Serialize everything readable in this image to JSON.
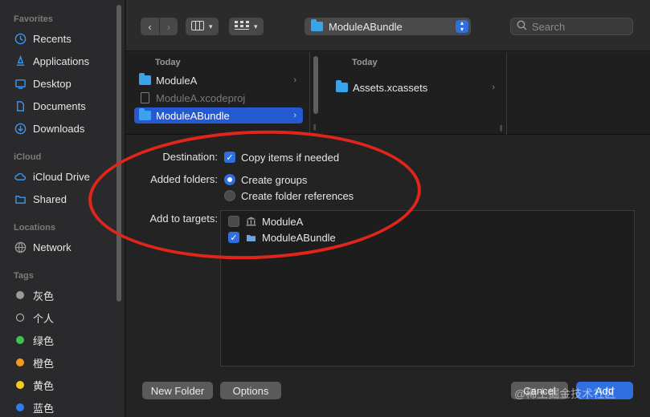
{
  "sidebar": {
    "sections": {
      "favorites": "Favorites",
      "icloud": "iCloud",
      "locations": "Locations",
      "tags": "Tags"
    },
    "favorites": [
      {
        "label": "Recents",
        "icon": "clock-icon"
      },
      {
        "label": "Applications",
        "icon": "applications-icon"
      },
      {
        "label": "Desktop",
        "icon": "desktop-icon"
      },
      {
        "label": "Documents",
        "icon": "document-icon"
      },
      {
        "label": "Downloads",
        "icon": "download-icon"
      }
    ],
    "icloud": [
      {
        "label": "iCloud Drive",
        "icon": "cloud-icon"
      },
      {
        "label": "Shared",
        "icon": "shared-folder-icon"
      }
    ],
    "locations": [
      {
        "label": "Network",
        "icon": "globe-icon"
      }
    ],
    "tags": [
      {
        "label": "灰色",
        "color": "#9a9a9a"
      },
      {
        "label": "个人",
        "color": "outline"
      },
      {
        "label": "绿色",
        "color": "#3fc350"
      },
      {
        "label": "橙色",
        "color": "#f39a1d"
      },
      {
        "label": "黄色",
        "color": "#f3cc1d"
      },
      {
        "label": "蓝色",
        "color": "#2e7cf6"
      }
    ]
  },
  "toolbar": {
    "back_icon": "chevron-left-icon",
    "forward_icon": "chevron-right-icon",
    "current_folder": "ModuleABundle",
    "search_placeholder": "Search"
  },
  "browser": {
    "col1_header": "Today",
    "col1_items": [
      {
        "label": "ModuleA",
        "type": "folder",
        "state": "normal"
      },
      {
        "label": "ModuleA.xcodeproj",
        "type": "file",
        "state": "disabled"
      },
      {
        "label": "ModuleABundle",
        "type": "folder",
        "state": "selected"
      }
    ],
    "col2_header": "Today",
    "col2_items": [
      {
        "label": "Assets.xcassets",
        "type": "folder"
      }
    ]
  },
  "options": {
    "destination_label": "Destination:",
    "copy_items": {
      "label": "Copy items if needed",
      "checked": true
    },
    "added_folders_label": "Added folders:",
    "create_groups": {
      "label": "Create groups",
      "selected": true
    },
    "create_folder_refs": {
      "label": "Create folder references",
      "selected": false
    },
    "add_to_targets_label": "Add to targets:",
    "targets": [
      {
        "label": "ModuleA",
        "checked": false,
        "icon": "bank-icon"
      },
      {
        "label": "ModuleABundle",
        "checked": true,
        "icon": "bundle-icon"
      }
    ]
  },
  "footer": {
    "new_folder": "New Folder",
    "options": "Options",
    "cancel": "Cancel",
    "add": "Add"
  },
  "watermark": "@稀土掘金技术社区",
  "colors": {
    "accent": "#2f6fe0",
    "annotation": "#e1251b",
    "folder": "#39a4ec"
  }
}
